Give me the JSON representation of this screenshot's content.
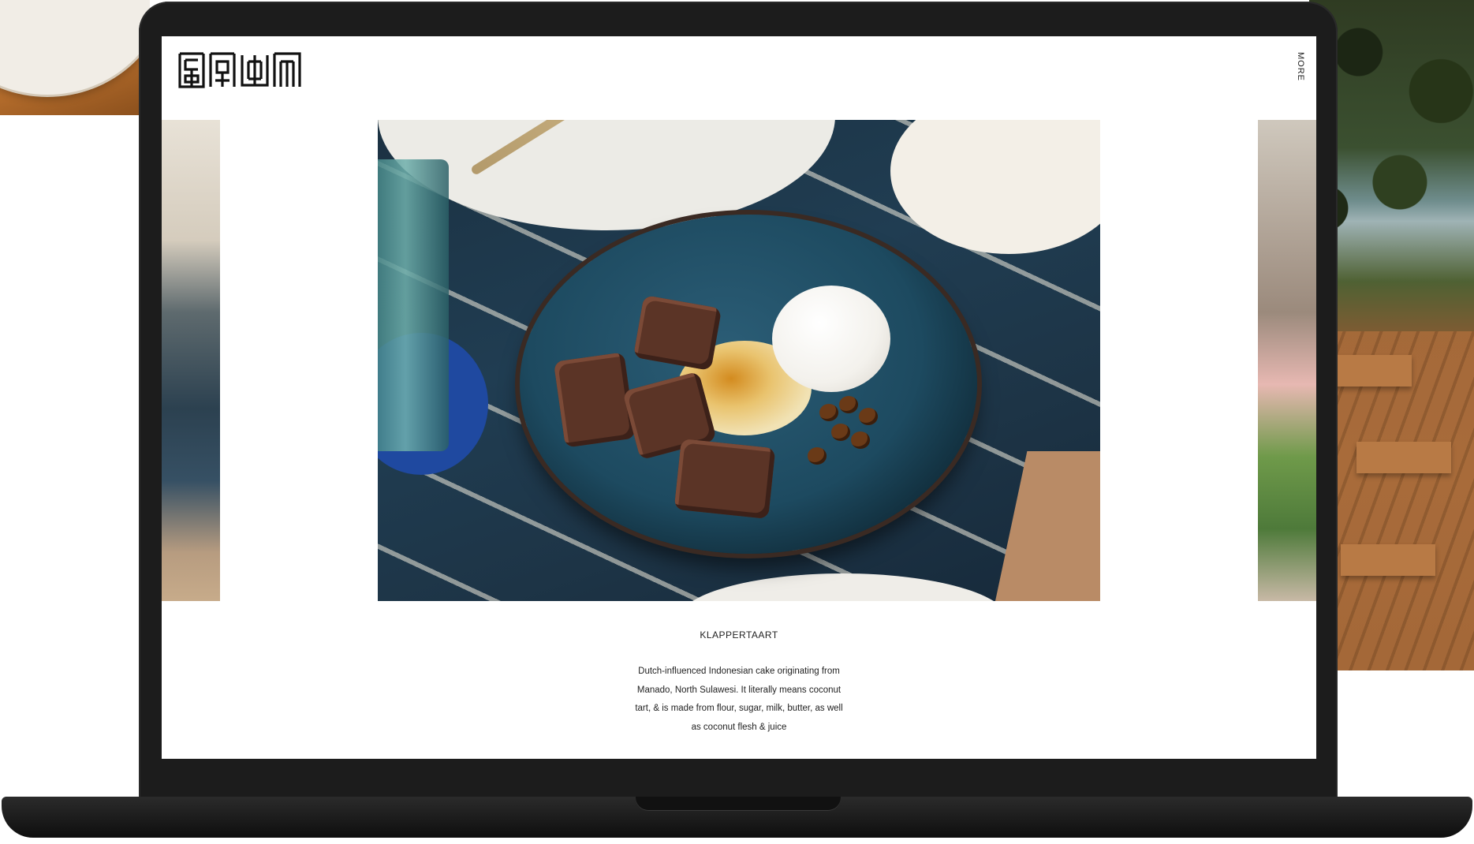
{
  "site": {
    "logo_icon": "brand-logo",
    "nav": {
      "more_label": "MORE"
    }
  },
  "dish": {
    "title": "KLAPPERTAART",
    "description": "Dutch-influenced Indonesian cake originating from Manado, North Sulawesi. It literally means coconut tart, & is made from flour, sugar, milk, butter, as well as coconut flesh & juice"
  },
  "colors": {
    "laptop_frame": "#1c1c1c",
    "screen_background": "#ffffff",
    "text": "#222222"
  }
}
